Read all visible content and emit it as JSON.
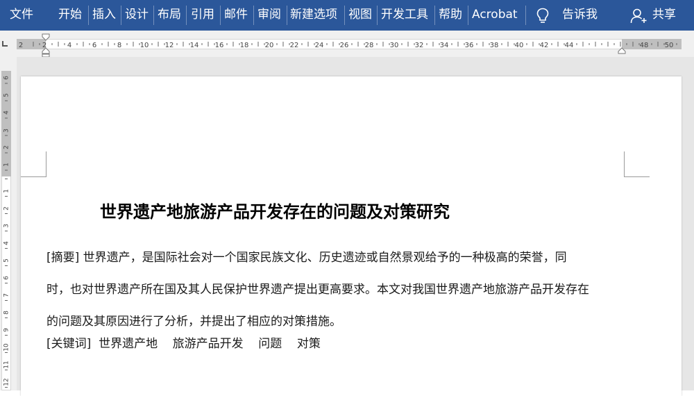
{
  "ribbon": {
    "tabs": [
      "文件",
      "开始",
      "插入",
      "设计",
      "布局",
      "引用",
      "邮件",
      "审阅",
      "新建选项",
      "视图",
      "开发工具",
      "帮助",
      "Acrobat"
    ],
    "tell_me": "告诉我",
    "share": "共享",
    "accent_color": "#2b579a"
  },
  "ruler": {
    "horizontal_numbers": [
      "2",
      "2",
      "4",
      "6",
      "8",
      "10",
      "12",
      "14",
      "16",
      "18",
      "20",
      "22",
      "24",
      "26",
      "28",
      "30",
      "32",
      "34",
      "36",
      "38",
      "40",
      "42",
      "44",
      "48",
      "50"
    ],
    "vertical_numbers": [
      "6",
      "5",
      "4",
      "3",
      "2",
      "1",
      "1",
      "2",
      "3",
      "4",
      "5",
      "6",
      "7",
      "8",
      "9",
      "10",
      "11",
      "12"
    ]
  },
  "document": {
    "title": "世界遗产地旅游产品开发存在的问题及对策研究",
    "abstract_lines": [
      "[摘要] 世界遗产，是国际社会对一个国家民族文化、历史遗迹或自然景观给予的一种极高的荣誉，同",
      "时，也对世界遗产所在国及其人民保护世界遗产提出更高要求。本文对我国世界遗产地旅游产品开发存在",
      "的问题及其原因进行了分析，并提出了相应的对策措施。"
    ],
    "keywords": "[关键词]  世界遗产地    旅游产品开发    问题    对策"
  }
}
